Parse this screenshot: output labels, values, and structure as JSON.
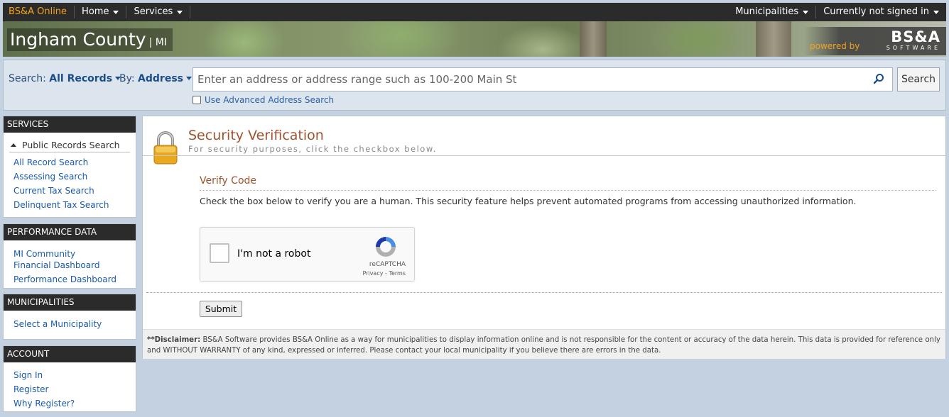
{
  "topnav": {
    "brand": "BS&A Online",
    "home": "Home",
    "services": "Services",
    "municipalities": "Municipalities",
    "signin_status": "Currently not signed in"
  },
  "banner": {
    "county": "Ingham County",
    "state": "| MI",
    "powered_by": "powered by",
    "logo": "BS&A",
    "logo_sub": "SOFTWARE"
  },
  "search": {
    "search_label": "Search:",
    "search_value": "All Records",
    "by_label": "By:",
    "by_value": "Address",
    "placeholder": "Enter an address or address range such as 100-200 Main St",
    "button": "Search",
    "advanced": "Use Advanced Address Search"
  },
  "sidebar": {
    "services": {
      "header": "SERVICES",
      "group": "Public Records Search",
      "items": [
        "All Record Search",
        "Assessing Search",
        "Current Tax Search",
        "Delinquent Tax Search"
      ]
    },
    "performance": {
      "header": "PERFORMANCE DATA",
      "items": [
        "MI Community Financial Dashboard",
        "Performance Dashboard"
      ]
    },
    "municipalities": {
      "header": "MUNICIPALITIES",
      "items": [
        "Select a Municipality"
      ]
    },
    "account": {
      "header": "ACCOUNT",
      "items": [
        "Sign In",
        "Register",
        "Why Register?"
      ]
    }
  },
  "main": {
    "title": "Security Verification",
    "subtitle": "For security purposes, click the checkbox below.",
    "verify_heading": "Verify Code",
    "description": "Check the box below to verify you are a human. This security feature helps prevent automated programs from accessing unauthorized information.",
    "captcha": {
      "label": "I'm not a robot",
      "brand": "reCAPTCHA",
      "links": "Privacy - Terms"
    },
    "submit": "Submit",
    "disclaimer_bold": "**Disclaimer:",
    "disclaimer_text": " BS&A Software provides BS&A Online as a way for municipalities to display information online and is not responsible for the content or accuracy of the data herein. This data is provided for reference only and WITHOUT WARRANTY of any kind, expressed or inferred. Please contact your local municipality if you believe there are errors in the data."
  },
  "colors": {
    "accent_orange": "#f5a21b",
    "heading_brown": "#a0522d",
    "link_blue": "#1a5aa8",
    "nav_dark": "#2b2b2b"
  }
}
